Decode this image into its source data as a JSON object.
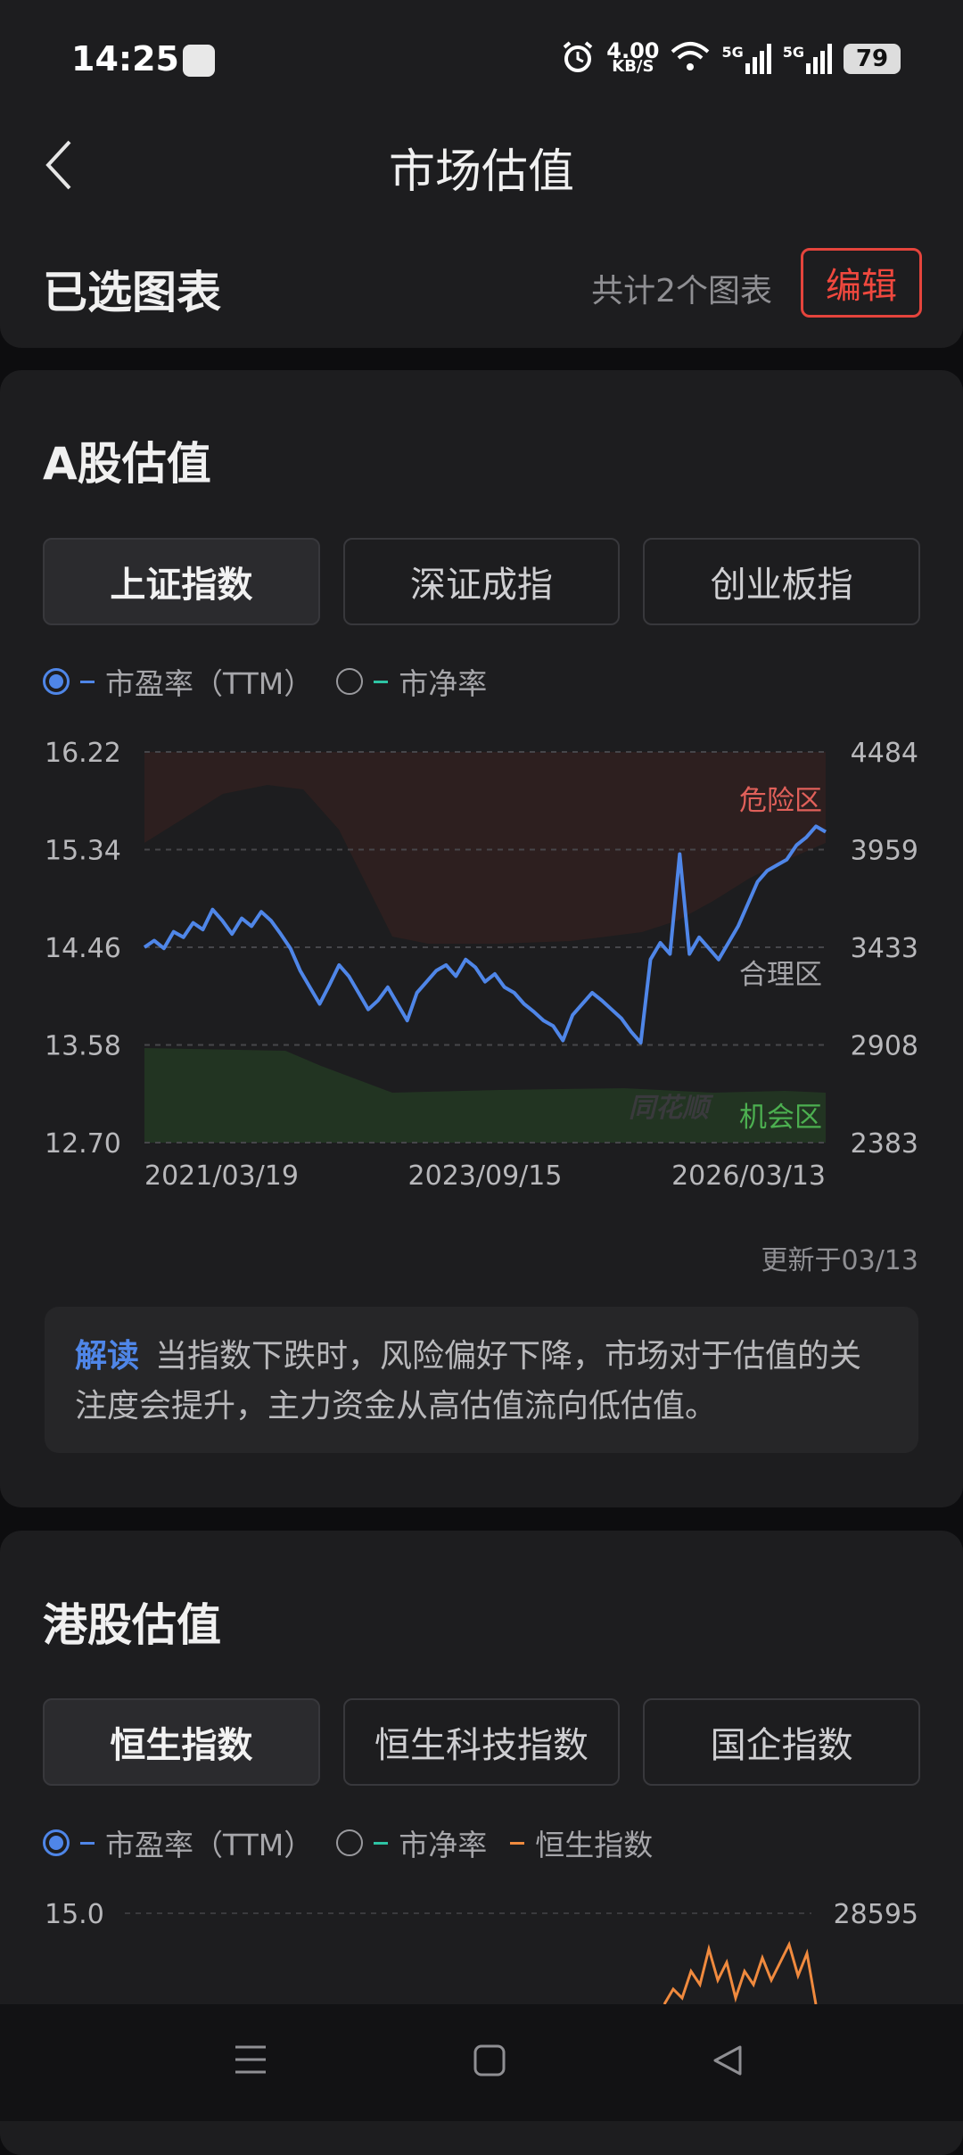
{
  "status_bar": {
    "time": "14:25",
    "net_speed_value": "4.00",
    "net_speed_unit": "KB/S",
    "signal1": "5G",
    "signal2": "5G",
    "battery": "79"
  },
  "header": {
    "title": "市场估值",
    "selected_title": "已选图表",
    "count_text": "共计2个图表",
    "edit_label": "编辑"
  },
  "a_share": {
    "title": "A股估值",
    "tabs": [
      "上证指数",
      "深证成指",
      "创业板指"
    ],
    "legend": {
      "pe": "市盈率（TTM）",
      "pb": "市净率"
    },
    "updated": "更新于03/13",
    "note_tag": "解读",
    "note_text": "当指数下跌时，风险偏好下降，市场对于估值的关注度会提升，主力资金从高估值流向低估值。"
  },
  "hk_share": {
    "title": "港股估值",
    "tabs": [
      "恒生指数",
      "恒生科技指数",
      "国企指数"
    ],
    "legend": {
      "pe": "市盈率（TTM）",
      "pb": "市净率",
      "index": "恒生指数"
    }
  },
  "colors": {
    "accent": "#4f86e8",
    "danger": "#f0483e",
    "pb_series": "#2ec4a4",
    "index_series": "#f08a3e",
    "zone_danger": "#e0605a",
    "zone_chance": "#4caf50"
  },
  "chart_data": [
    {
      "type": "line",
      "left_ticks": [
        "16.22",
        "15.34",
        "14.46",
        "13.58",
        "12.70"
      ],
      "right_ticks": [
        "4484",
        "3959",
        "3433",
        "2908",
        "2383"
      ],
      "x_ticks": [
        "2021/03/19",
        "2023/09/15",
        "2026/03/13"
      ],
      "ylim": [
        12.7,
        16.22
      ],
      "zones": {
        "danger": "危险区",
        "fair": "合理区",
        "chance": "机会区"
      },
      "watermark": "同花顺",
      "series": [
        {
          "values": [
            14.46,
            14.52,
            14.45,
            14.6,
            14.55,
            14.68,
            14.62,
            14.8,
            14.7,
            14.58,
            14.72,
            14.65,
            14.78,
            14.7,
            14.58,
            14.45,
            14.25,
            14.1,
            13.95,
            14.12,
            14.3,
            14.2,
            14.05,
            13.9,
            13.98,
            14.1,
            13.95,
            13.8,
            14.05,
            14.15,
            14.25,
            14.3,
            14.2,
            14.35,
            14.28,
            14.15,
            14.22,
            14.1,
            14.05,
            13.95,
            13.88,
            13.8,
            13.75,
            13.62,
            13.85,
            13.95,
            14.05,
            13.98,
            13.9,
            13.82,
            13.7,
            13.6,
            14.35,
            14.5,
            14.4,
            15.3,
            14.4,
            14.55,
            14.45,
            14.35,
            14.5,
            14.65,
            14.85,
            15.05,
            15.15,
            15.2,
            15.25,
            15.38,
            15.45,
            15.55,
            15.5
          ]
        }
      ]
    },
    {
      "type": "line",
      "left_ticks": [
        "15.0"
      ],
      "right_ticks": [
        "28595"
      ]
    }
  ]
}
